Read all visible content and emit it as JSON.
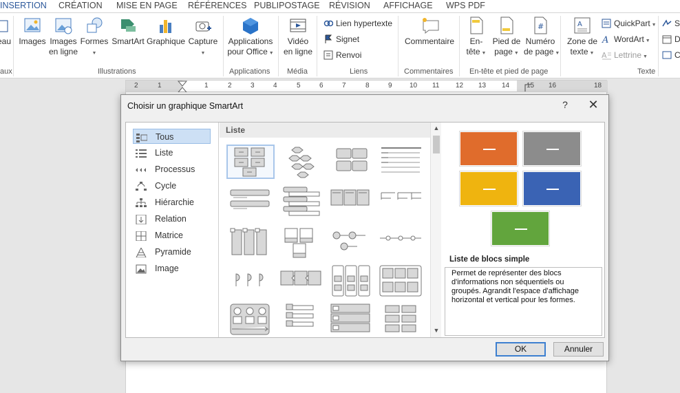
{
  "ribbon": {
    "tabs": [
      "INSERTION",
      "CRÉATION",
      "MISE EN PAGE",
      "RÉFÉRENCES",
      "PUBLIPOSTAGE",
      "RÉVISION",
      "AFFICHAGE",
      "WPS PDF"
    ],
    "buttons": {
      "tableau_fragment": "eau",
      "images": "Images",
      "images_en_ligne_1": "Images",
      "images_en_ligne_2": "en ligne",
      "formes": "Formes",
      "smartart": "SmartArt",
      "graphique": "Graphique",
      "capture": "Capture",
      "apps_1": "Applications",
      "apps_2": "pour Office",
      "video_1": "Vidéo",
      "video_2": "en ligne",
      "lien": "Lien hypertexte",
      "signet": "Signet",
      "renvoi": "Renvoi",
      "commentaire": "Commentaire",
      "entete_1": "En-",
      "entete_2": "tête",
      "pied_1": "Pied de",
      "pied_2": "page",
      "numero_1": "Numéro",
      "numero_2": "de page",
      "zone_1": "Zone de",
      "zone_2": "texte",
      "quickpart": "QuickPart",
      "wordart": "WordArt",
      "lettrine": "Lettrine",
      "frag_s": "S",
      "frag_d": "D",
      "frag_c": "C"
    },
    "groups": {
      "tableaux_fragment": "aux",
      "illustrations": "Illustrations",
      "applications": "Applications",
      "media": "Média",
      "liens": "Liens",
      "commentaires": "Commentaires",
      "entete_pied": "En-tête et pied de page",
      "texte": "Texte"
    },
    "colors": {
      "active_tab": "#2b579a"
    }
  },
  "ruler": {
    "numbers": [
      "2",
      "1",
      "1",
      "2",
      "3",
      "4",
      "5",
      "6",
      "7",
      "8",
      "9",
      "10",
      "11",
      "12",
      "13",
      "14",
      "15",
      "16",
      "18"
    ]
  },
  "dialog": {
    "title": "Choisir un graphique SmartArt",
    "help": "?",
    "close": "✕",
    "categories": [
      {
        "label": "Tous",
        "icon": "all-icon",
        "selected": true
      },
      {
        "label": "Liste",
        "icon": "list-icon"
      },
      {
        "label": "Processus",
        "icon": "process-icon"
      },
      {
        "label": "Cycle",
        "icon": "cycle-icon"
      },
      {
        "label": "Hiérarchie",
        "icon": "hierarchy-icon"
      },
      {
        "label": "Relation",
        "icon": "relation-icon"
      },
      {
        "label": "Matrice",
        "icon": "matrix-icon"
      },
      {
        "label": "Pyramide",
        "icon": "pyramid-icon"
      },
      {
        "label": "Image",
        "icon": "image-icon"
      }
    ],
    "gallery_header": "Liste",
    "preview": {
      "title": "Liste de blocs simple",
      "description": "Permet de représenter des blocs d'informations non séquentiels ou groupés. Agrandit l'espace d'affichage horizontal et vertical pour les formes.",
      "block_colors": [
        "#e06c2c",
        "#8c8c8c",
        "#efb40f",
        "#3a63b4",
        "#62a53d"
      ]
    },
    "ok": "OK",
    "cancel": "Annuler"
  }
}
